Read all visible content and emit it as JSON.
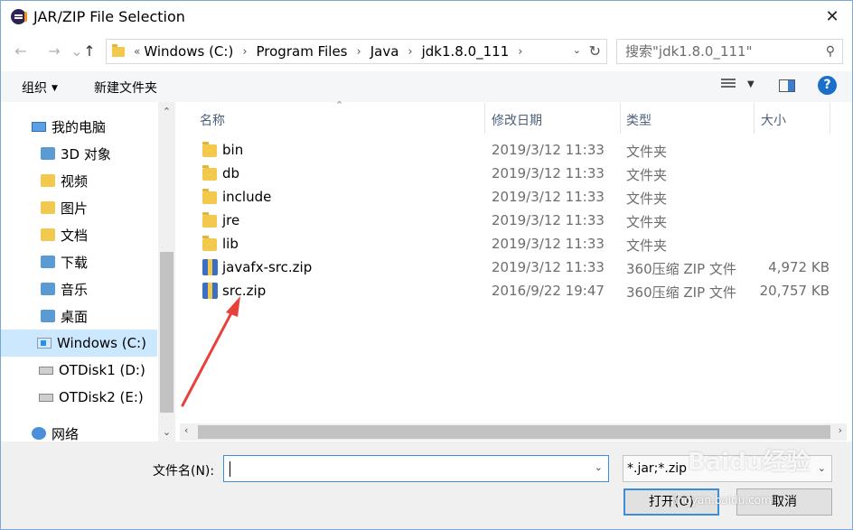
{
  "window": {
    "title": "JAR/ZIP File Selection",
    "close": "✕"
  },
  "nav": {
    "back": "←",
    "forward": "→",
    "up": "↑"
  },
  "address": {
    "overflow": "«",
    "crumbs": [
      "Windows (C:)",
      "Program Files",
      "Java",
      "jdk1.8.0_111"
    ]
  },
  "search": {
    "placeholder": "搜索\"jdk1.8.0_111\""
  },
  "toolbar": {
    "organize": "组织",
    "new_folder": "新建文件夹",
    "help": "?"
  },
  "sidebar": {
    "items": [
      {
        "label": "我的电脑",
        "icon": "computer-icon"
      },
      {
        "label": "3D 对象",
        "icon": "3d-objects-icon"
      },
      {
        "label": "视频",
        "icon": "videos-icon"
      },
      {
        "label": "图片",
        "icon": "pictures-icon"
      },
      {
        "label": "文档",
        "icon": "documents-icon"
      },
      {
        "label": "下载",
        "icon": "downloads-icon"
      },
      {
        "label": "音乐",
        "icon": "music-icon"
      },
      {
        "label": "桌面",
        "icon": "desktop-icon"
      },
      {
        "label": "Windows (C:)",
        "icon": "windows-drive-icon",
        "selected": true
      },
      {
        "label": "OTDisk1 (D:)",
        "icon": "drive-icon"
      },
      {
        "label": "OTDisk2 (E:)",
        "icon": "drive-icon"
      },
      {
        "label": "网络",
        "icon": "network-icon"
      }
    ]
  },
  "columns": {
    "name": "名称",
    "date": "修改日期",
    "type": "类型",
    "size": "大小"
  },
  "files": [
    {
      "name": "bin",
      "date": "2019/3/12 11:33",
      "type": "文件夹",
      "size": "",
      "kind": "folder"
    },
    {
      "name": "db",
      "date": "2019/3/12 11:33",
      "type": "文件夹",
      "size": "",
      "kind": "folder"
    },
    {
      "name": "include",
      "date": "2019/3/12 11:33",
      "type": "文件夹",
      "size": "",
      "kind": "folder"
    },
    {
      "name": "jre",
      "date": "2019/3/12 11:33",
      "type": "文件夹",
      "size": "",
      "kind": "folder"
    },
    {
      "name": "lib",
      "date": "2019/3/12 11:33",
      "type": "文件夹",
      "size": "",
      "kind": "folder"
    },
    {
      "name": "javafx-src.zip",
      "date": "2019/3/12 11:33",
      "type": "360压缩 ZIP 文件",
      "size": "4,972 KB",
      "kind": "zip"
    },
    {
      "name": "src.zip",
      "date": "2016/9/22 19:47",
      "type": "360压缩 ZIP 文件",
      "size": "20,757 KB",
      "kind": "zip"
    }
  ],
  "footer": {
    "filename_label": "文件名(N):",
    "filename_value": "",
    "filter": "*.jar;*.zip",
    "open": "打开(O)",
    "cancel": "取消"
  },
  "watermark": {
    "brand": "Baidu经验",
    "url": "jingyan.baidu.com"
  },
  "colors": {
    "selection": "#cce8ff",
    "accent": "#3c8ed8",
    "annotation": "#e8413a"
  }
}
